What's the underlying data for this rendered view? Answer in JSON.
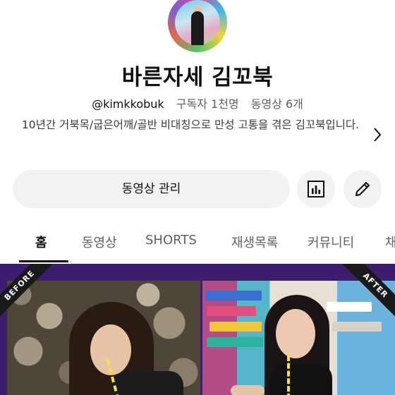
{
  "channel": {
    "name": "바른자세 김꼬북",
    "handle": "@kimkkobuk",
    "subscribers": "구독자 1천명",
    "videos": "동영상 6개",
    "description": "10년간 거북목/굽은어깨/골반 비대칭으로 만성 고통을 겪은 김꼬북입니다."
  },
  "actions": {
    "manage_videos": "동영상 관리",
    "stats_icon": "bar-chart-icon",
    "edit_icon": "pencil-icon"
  },
  "tabs": [
    {
      "label": "홈",
      "active": true
    },
    {
      "label": "동영상",
      "active": false
    },
    {
      "label": "SHORTS",
      "active": false
    },
    {
      "label": "재생목록",
      "active": false
    },
    {
      "label": "커뮤니티",
      "active": false
    },
    {
      "label": "채",
      "active": false
    }
  ],
  "banner": {
    "before_label": "BEFORE",
    "after_label": "AFTER",
    "background_color": "#3c1d6e",
    "guide_line_color": "#f0e24a"
  }
}
